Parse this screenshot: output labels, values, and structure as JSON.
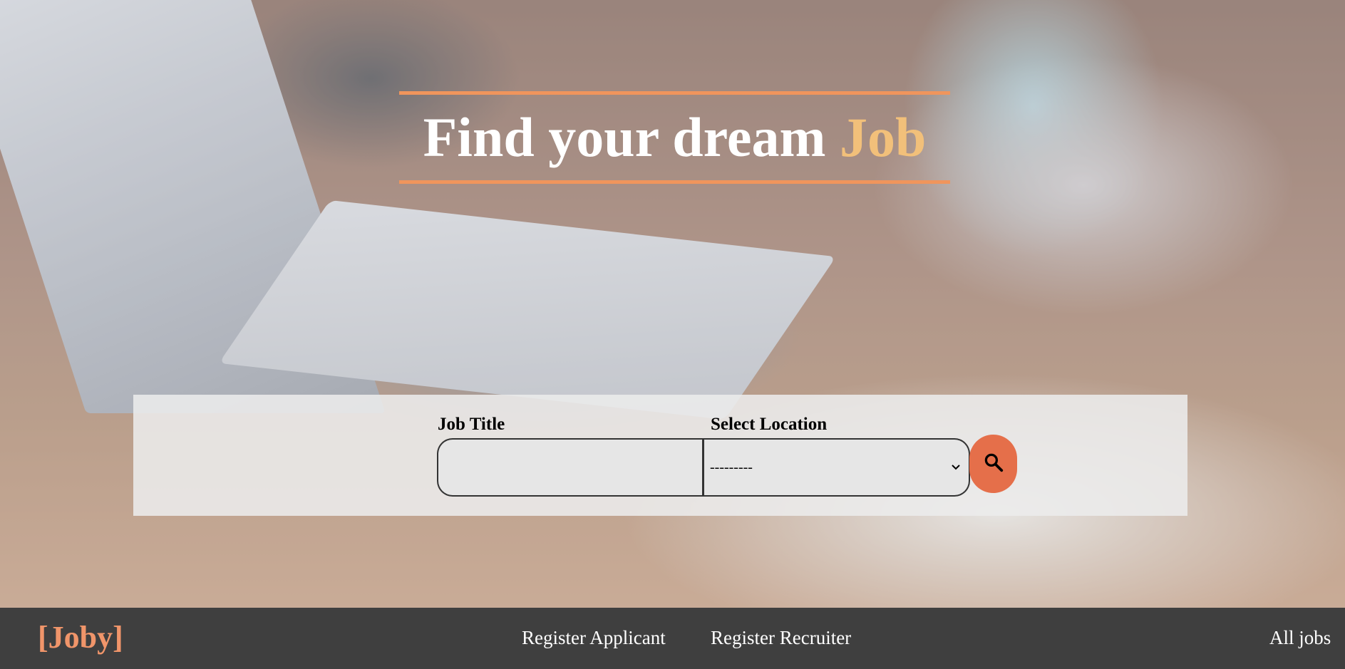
{
  "hero": {
    "headline_main": "Find your dream ",
    "headline_accent": "Job"
  },
  "search": {
    "job_title_label": "Job Title",
    "job_title_value": "",
    "location_label": "Select Location",
    "location_selected": "---------",
    "search_icon": "search-icon"
  },
  "footer": {
    "brand": "[Joby]",
    "nav": {
      "register_applicant": "Register Applicant",
      "register_recruiter": "Register Recruiter",
      "all_jobs": "All jobs"
    }
  },
  "colors": {
    "accent_orange": "#f0955c",
    "headline_accent": "#f2c07a",
    "search_button": "#e56f4a",
    "brand": "#f0956a",
    "footer_bg": "#3f3f3f"
  }
}
